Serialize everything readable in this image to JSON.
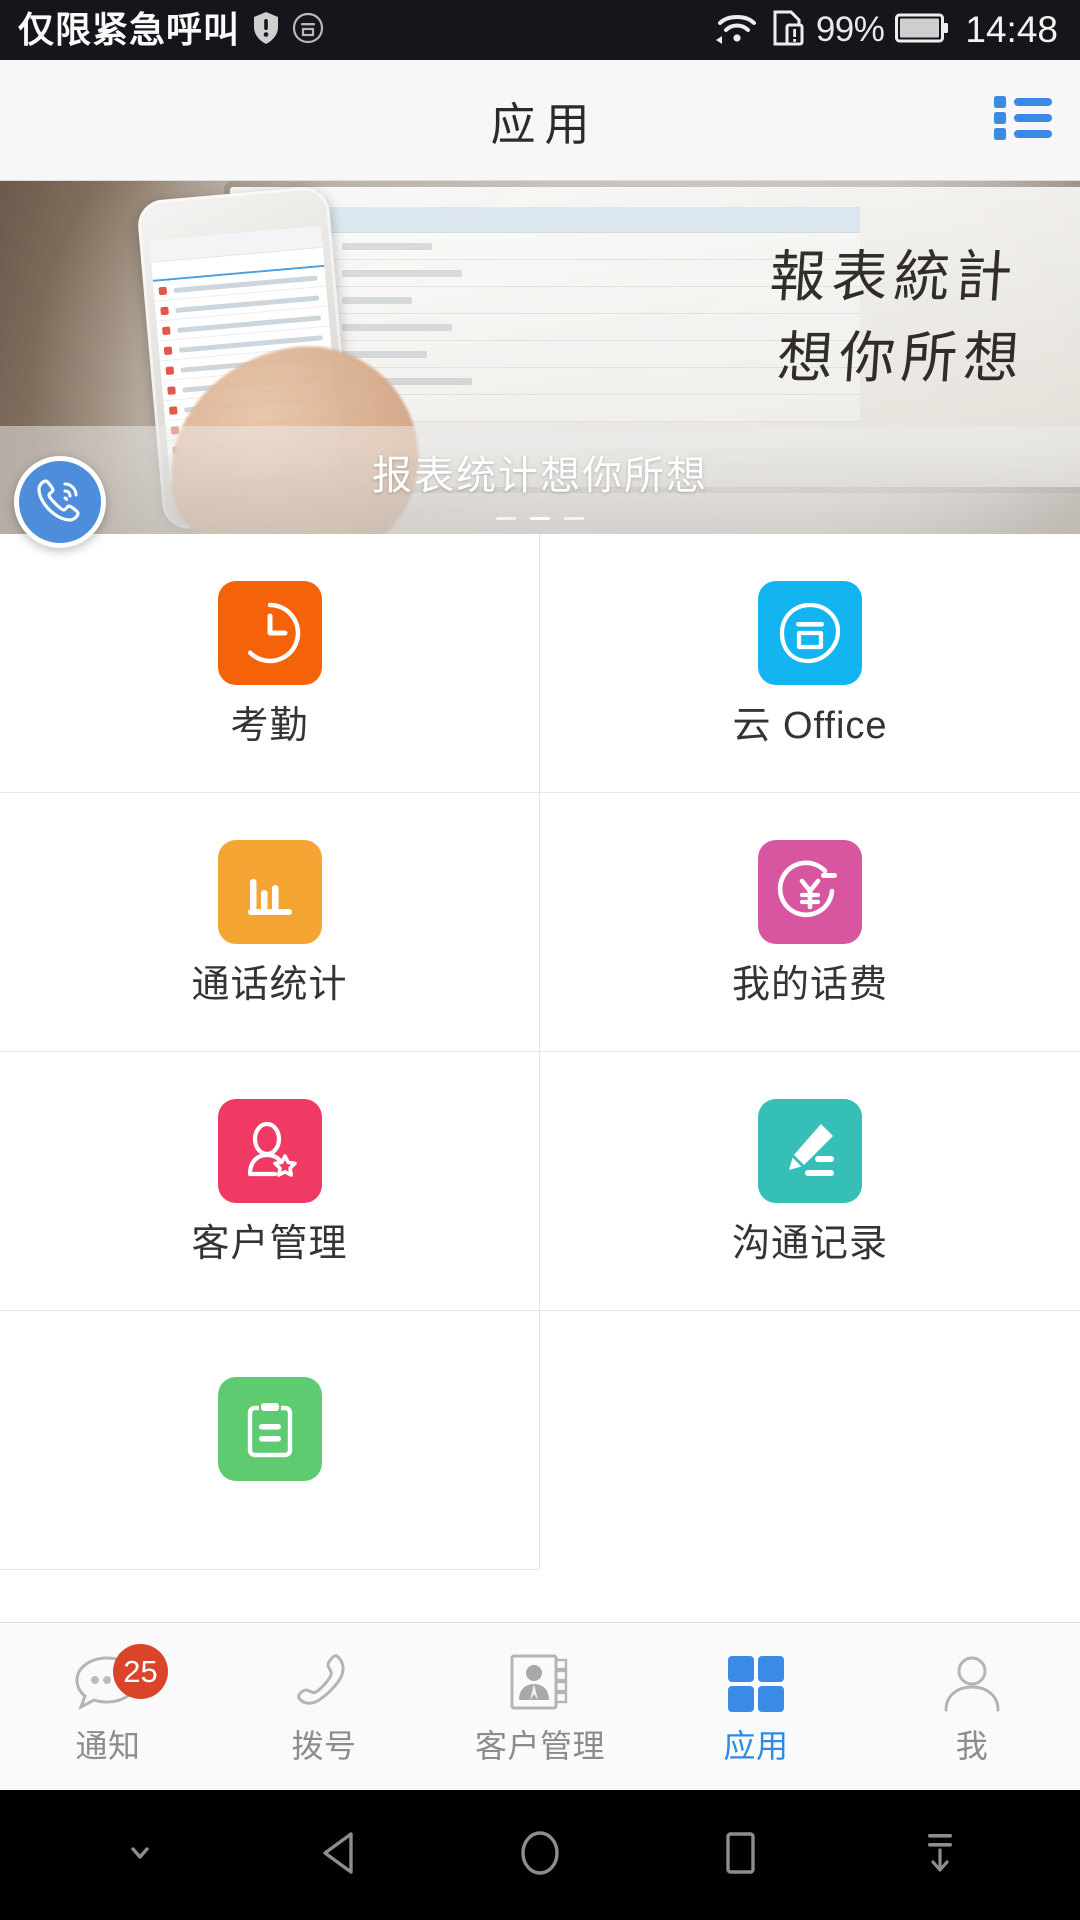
{
  "status_bar": {
    "carrier_text": "仅限紧急呼叫",
    "icons": [
      "shield-warning-icon",
      "cloud-office-icon",
      "wifi-icon",
      "sim-warning-icon"
    ],
    "battery_percent": "99%",
    "clock": "14:48"
  },
  "header": {
    "title": "应用",
    "menu_icon": "list-menu-icon",
    "accent_color": "#3b8ae5"
  },
  "banner": {
    "caption": "报表统计想你所想",
    "calligraphy_line1": "報表統計",
    "calligraphy_line2": "想你所想",
    "page_indicator_count": 3,
    "active_index": 1,
    "fab": {
      "name": "call-fab",
      "icon": "phone-call-icon",
      "color": "#4d8ddb"
    }
  },
  "apps": [
    {
      "label": "考勤",
      "icon": "clock-icon",
      "color": "#f4620a"
    },
    {
      "label": "云 Office",
      "icon": "cloud-office-icon",
      "color": "#13b5f0"
    },
    {
      "label": "通话统计",
      "icon": "bar-chart-icon",
      "color": "#f5a533"
    },
    {
      "label": "我的话费",
      "icon": "yen-circle-icon",
      "color": "#d8569f"
    },
    {
      "label": "客户管理",
      "icon": "person-star-icon",
      "color": "#f03a63"
    },
    {
      "label": "沟通记录",
      "icon": "pencil-note-icon",
      "color": "#35bfb6"
    },
    {
      "label": "",
      "icon": "clipboard-icon",
      "color": "#5ecb71"
    }
  ],
  "tabs": [
    {
      "label": "通知",
      "icon": "chat-bubble-icon",
      "badge": "25",
      "active": false
    },
    {
      "label": "拨号",
      "icon": "phone-handset-icon",
      "badge": "",
      "active": false
    },
    {
      "label": "客户管理",
      "icon": "contact-card-icon",
      "badge": "",
      "active": false
    },
    {
      "label": "应用",
      "icon": "grid-squares-icon",
      "badge": "",
      "active": true
    },
    {
      "label": "我",
      "icon": "person-icon",
      "badge": "",
      "active": false
    }
  ],
  "nav_bar": {
    "buttons": [
      {
        "name": "hide-keyboard-button",
        "icon": "chevron-down-icon"
      },
      {
        "name": "back-button",
        "icon": "triangle-back-icon"
      },
      {
        "name": "home-button",
        "icon": "circle-home-icon"
      },
      {
        "name": "recents-button",
        "icon": "square-recents-icon"
      },
      {
        "name": "notification-pull-button",
        "icon": "pull-down-icon"
      }
    ]
  }
}
